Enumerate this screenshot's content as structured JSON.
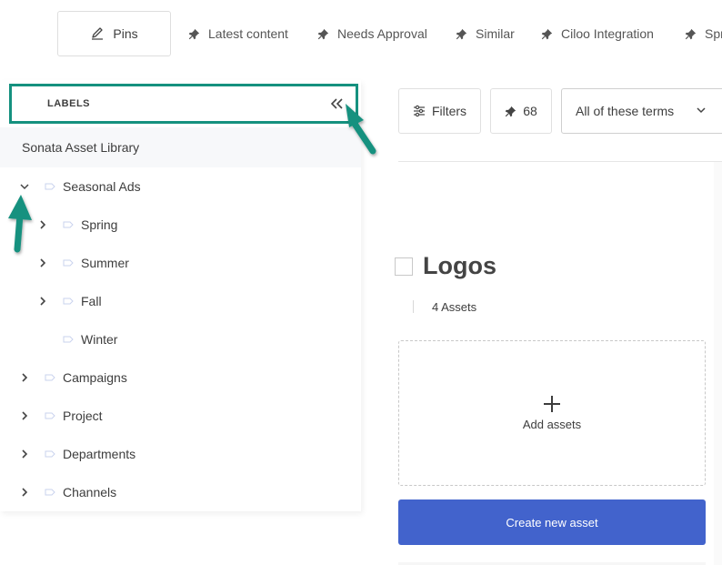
{
  "pins_bar": {
    "pins_button_label": "Pins",
    "tabs": [
      {
        "label": "Latest content",
        "icon": "pin-icon"
      },
      {
        "label": "Needs Approval",
        "icon": "pin-icon"
      },
      {
        "label": "Similar",
        "icon": "pin-icon"
      },
      {
        "label": "Ciloo Integration",
        "icon": "pin-icon"
      },
      {
        "label": "Spr",
        "icon": "pin-icon"
      }
    ]
  },
  "sidebar": {
    "header_title": "LABELS",
    "collapse_icon": "double-chevron-left-icon",
    "library_name": "Sonata Asset Library",
    "tree": [
      {
        "label": "Seasonal Ads",
        "level": 0,
        "expanded": true,
        "has_children": true
      },
      {
        "label": "Spring",
        "level": 1,
        "expanded": false,
        "has_children": true
      },
      {
        "label": "Summer",
        "level": 1,
        "expanded": false,
        "has_children": true
      },
      {
        "label": "Fall",
        "level": 1,
        "expanded": false,
        "has_children": true
      },
      {
        "label": "Winter",
        "level": 1,
        "expanded": false,
        "has_children": false
      },
      {
        "label": "Campaigns",
        "level": 0,
        "expanded": false,
        "has_children": true
      },
      {
        "label": "Project",
        "level": 0,
        "expanded": false,
        "has_children": true
      },
      {
        "label": "Departments",
        "level": 0,
        "expanded": false,
        "has_children": true
      },
      {
        "label": "Channels",
        "level": 0,
        "expanded": false,
        "has_children": true
      }
    ]
  },
  "toolbar": {
    "filters_label": "Filters",
    "pin_count": "68",
    "terms_select_value": "All of these terms"
  },
  "collection": {
    "title": "Logos",
    "asset_count": "4 Assets",
    "add_assets_label": "Add assets",
    "create_button_label": "Create new asset"
  },
  "colors": {
    "annotation_teal": "#15917f",
    "primary_button": "#4263cc",
    "tag_icon": "#c9d3ee"
  }
}
